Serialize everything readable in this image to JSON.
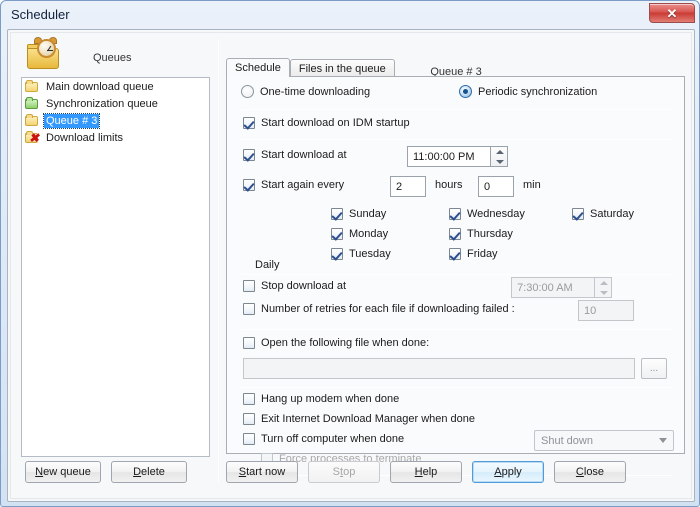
{
  "window": {
    "title": "Scheduler",
    "close_label": "✕"
  },
  "left": {
    "header_label": "Queues",
    "icon": "scheduler-folder-clock-icon",
    "queues": [
      {
        "label": "Main download queue",
        "icon": "folder-yellow-icon",
        "selected": false
      },
      {
        "label": "Synchronization queue",
        "icon": "folder-green-icon",
        "selected": false
      },
      {
        "label": "Queue # 3",
        "icon": "folder-yellow-icon",
        "selected": true
      },
      {
        "label": "Download limits",
        "icon": "folder-limits-icon",
        "selected": false
      }
    ],
    "buttons": {
      "new_queue": "New queue",
      "new_queue_accel": "N",
      "delete": "Delete",
      "delete_accel": "D"
    }
  },
  "right": {
    "queue_title": "Queue # 3",
    "tabs": [
      {
        "label": "Schedule",
        "active": true
      },
      {
        "label": "Files in the queue",
        "active": false
      }
    ],
    "mode": {
      "one_time": "One-time downloading",
      "periodic": "Periodic synchronization",
      "selected": "periodic"
    },
    "start_on_startup": {
      "label": "Start download on IDM startup",
      "checked": true
    },
    "start_download_at": {
      "label": "Start download at",
      "checked": true,
      "value": "11:00:00 PM"
    },
    "start_again_every": {
      "label": "Start again every",
      "checked": true,
      "hours_value": "2",
      "hours_label": "hours",
      "min_value": "0",
      "min_label": "min"
    },
    "daily_label": "Daily",
    "days": [
      {
        "label": "Sunday",
        "checked": true
      },
      {
        "label": "Monday",
        "checked": true
      },
      {
        "label": "Tuesday",
        "checked": true
      },
      {
        "label": "Wednesday",
        "checked": true
      },
      {
        "label": "Thursday",
        "checked": true
      },
      {
        "label": "Friday",
        "checked": true
      },
      {
        "label": "Saturday",
        "checked": true
      }
    ],
    "stop_download_at": {
      "label": "Stop download at",
      "checked": false,
      "value": "7:30:00 AM"
    },
    "retries": {
      "label": "Number of retries for each file if downloading failed :",
      "checked": false,
      "value": "10"
    },
    "open_file": {
      "label": "Open the following file when done:",
      "checked": false,
      "value": "",
      "browse_label": "..."
    },
    "hang_up_modem": {
      "label": "Hang up modem when done",
      "checked": false
    },
    "exit_idm": {
      "label": "Exit Internet Download Manager when done",
      "checked": false
    },
    "turn_off_computer": {
      "label": "Turn off computer when done",
      "checked": false
    },
    "force_terminate": {
      "label": "Force processes to terminate",
      "checked": false,
      "disabled": true
    },
    "shutdown_select": {
      "value": "Shut down",
      "disabled": true
    },
    "buttons": {
      "start_now": "Start now",
      "start_now_accel": "S",
      "stop": "Stop",
      "stop_accel": "t",
      "stop_disabled": true,
      "help": "Help",
      "help_accel": "H",
      "apply": "Apply",
      "apply_accel": "A",
      "apply_default": true,
      "close": "Close",
      "close_accel": "C"
    }
  },
  "colors": {
    "selection": "#3399ff",
    "titlebar": "#eaf1f9",
    "close_red": "#c93b34",
    "default_button_border": "#4f9bd9"
  }
}
